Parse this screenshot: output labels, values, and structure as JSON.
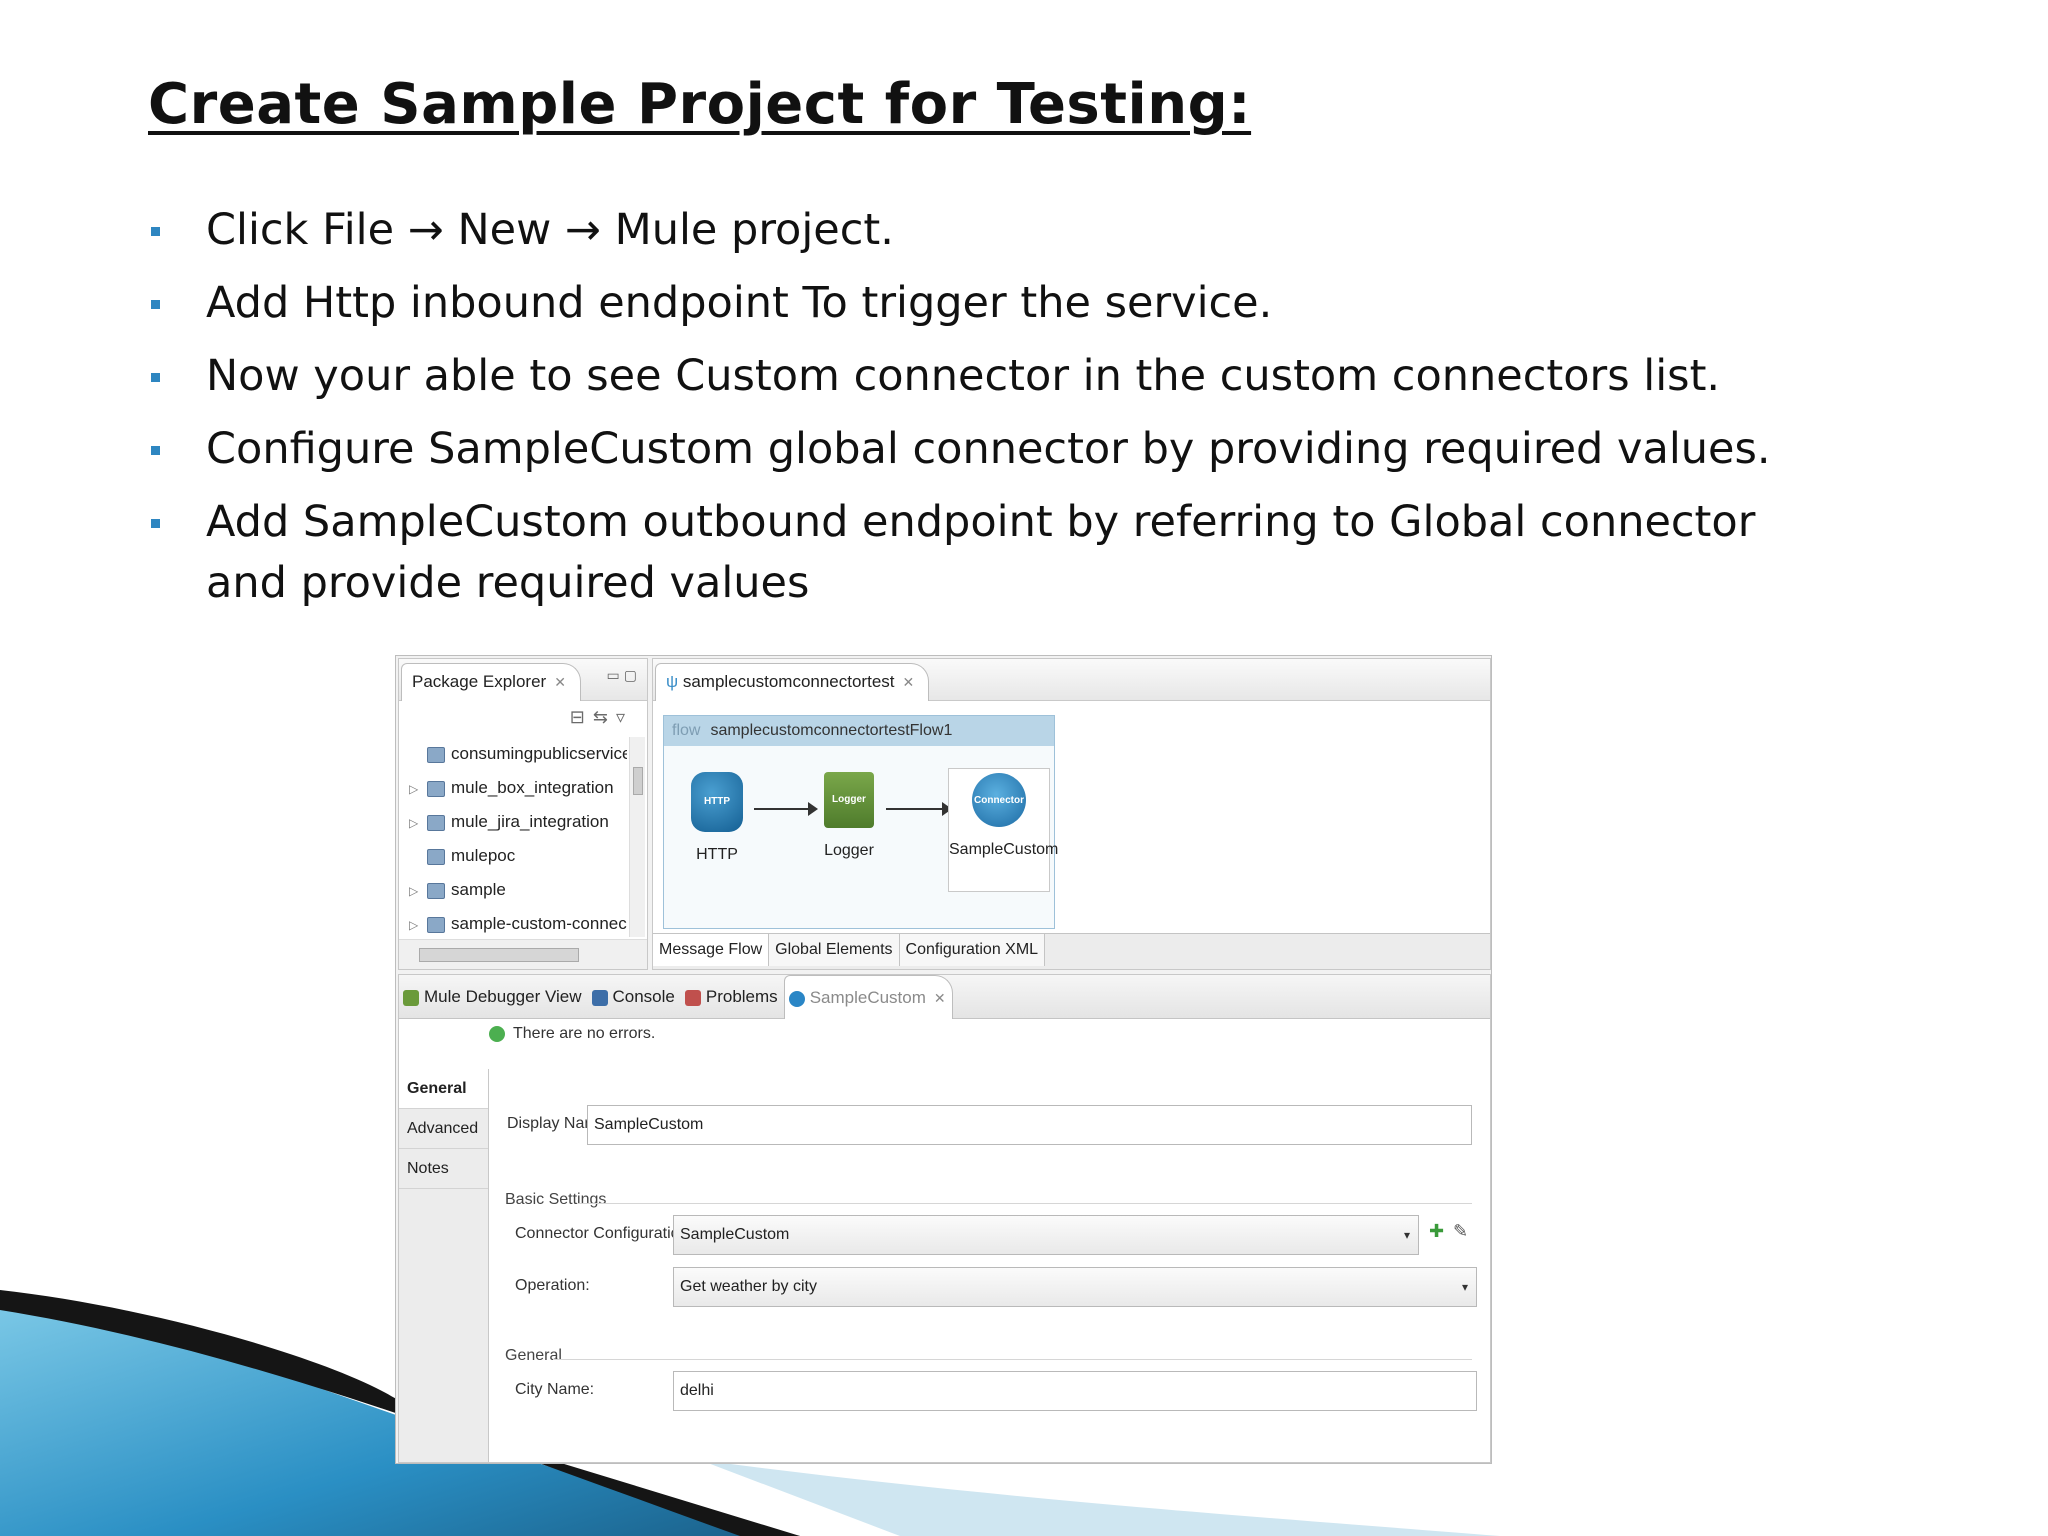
{
  "slide": {
    "title": "Create Sample Project for Testing:",
    "bullets": [
      "Click File → New → Mule project.",
      "Add Http inbound endpoint To trigger the service.",
      "Now your able to see Custom connector in the custom connectors list.",
      "Configure SampleCustom global connector by providing required values.",
      "Add SampleCustom outbound endpoint by referring to Global connector and provide required values"
    ]
  },
  "ide": {
    "package_explorer": {
      "tab_label": "Package Explorer",
      "items": [
        "consumingpublicservice",
        "mule_box_integration",
        "mule_jira_integration",
        "mulepoc",
        "sample",
        "sample-custom-connector"
      ]
    },
    "editor": {
      "tab_label": "samplecustomconnectortest",
      "flow_keyword": "flow",
      "flow_name": "samplecustomconnectortestFlow1",
      "nodes": {
        "http": "HTTP",
        "logger": "Logger",
        "custom": "SampleCustom"
      },
      "icon_text": {
        "http": "HTTP",
        "logger": "Logger",
        "custom": "Connector"
      },
      "bottom_tabs": [
        "Message Flow",
        "Global Elements",
        "Configuration XML"
      ]
    },
    "bottom_panel": {
      "tabs": [
        "Mule Debugger View",
        "Console",
        "Problems",
        "SampleCustom"
      ],
      "status": "There are no errors.",
      "side_tabs": [
        "General",
        "Advanced",
        "Notes"
      ],
      "display_name_label": "Display Name:",
      "display_name_value": "SampleCustom",
      "basic_settings_label": "Basic Settings",
      "connector_config_label": "Connector Configuration:",
      "connector_config_value": "SampleCustom",
      "operation_label": "Operation:",
      "operation_value": "Get weather by city",
      "general_group_label": "General",
      "city_name_label": "City Name:",
      "city_name_value": "delhi"
    }
  },
  "colors": {
    "bullet": "#2e86c1",
    "swoosh_light": "#5bb6dc",
    "swoosh_dark": "#1f6e99"
  }
}
